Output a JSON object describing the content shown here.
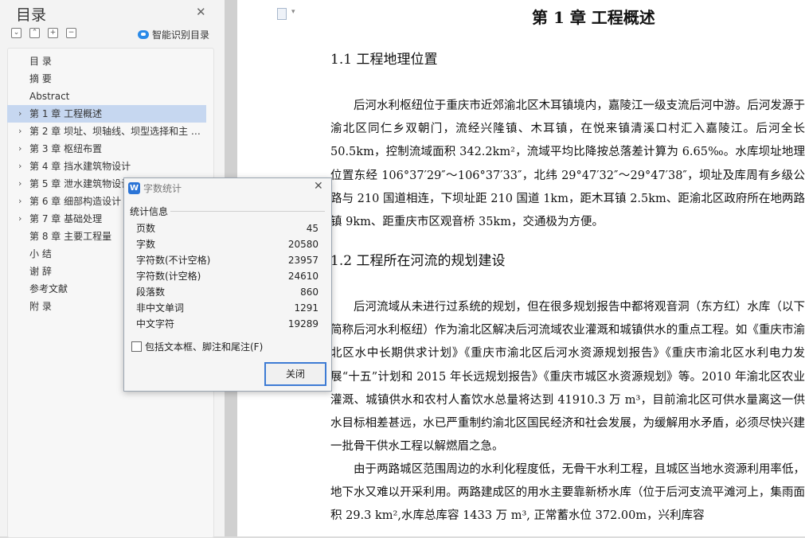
{
  "sidebar": {
    "title": "目录",
    "smart_label": "智能识别目录",
    "tools": [
      "collapse-all-icon",
      "expand-all-icon",
      "add-icon",
      "remove-icon"
    ],
    "items": [
      {
        "label": "目 录",
        "arrow": false,
        "active": false
      },
      {
        "label": "摘 要",
        "arrow": false,
        "active": false
      },
      {
        "label": "Abstract",
        "arrow": false,
        "active": false
      },
      {
        "label": "第 1 章  工程概述",
        "arrow": true,
        "active": true
      },
      {
        "label": "第 2 章  坝址、坝轴线、坝型选择和主 …",
        "arrow": true,
        "active": false
      },
      {
        "label": "第 3 章  枢纽布置",
        "arrow": true,
        "active": false
      },
      {
        "label": "第 4 章  挡水建筑物设计",
        "arrow": true,
        "active": false
      },
      {
        "label": "第 5 章  泄水建筑物设计",
        "arrow": true,
        "active": false
      },
      {
        "label": "第 6 章  细部构造设计",
        "arrow": true,
        "active": false
      },
      {
        "label": "第 7 章  基础处理",
        "arrow": true,
        "active": false
      },
      {
        "label": "第 8 章  主要工程量",
        "arrow": false,
        "active": false
      },
      {
        "label": "小  结",
        "arrow": false,
        "active": false
      },
      {
        "label": "谢  辞",
        "arrow": false,
        "active": false
      },
      {
        "label": "参考文献",
        "arrow": false,
        "active": false
      },
      {
        "label": "附 录",
        "arrow": false,
        "active": false
      }
    ]
  },
  "document": {
    "chapter_title": "第  1 章  工程概述",
    "h1_1": "1.1  工程地理位置",
    "p1": "后河水利枢纽位于重庆市近郊渝北区木耳镇境内，嘉陵江一级支流后河中游。后河发源于渝北区同仁乡双朝门，流经兴隆镇、木耳镇，在悦来镇清溪口村汇入嘉陵江。后河全长 50.5km，控制流域面积 342.2km²，流域平均比降按总落差计算为 6.65‰。水库坝址地理位置东经 106°37′29″～106°37′33″，北纬 29°47′32″～29°47′38″，坝址及库周有乡级公路与 210 国道相连，下坝址距 210 国道 1km，距木耳镇 2.5km、距渝北区政府所在地两路镇 9km、距重庆市区观音桥 35km，交通极为方便。",
    "h1_2": "1.2  工程所在河流的规划建设",
    "p2": "后河流域从未进行过系统的规划，但在很多规划报告中都将观音洞（东方红）水库（以下简称后河水利枢纽）作为渝北区解决后河流域农业灌溉和城镇供水的重点工程。如《重庆市渝北区水中长期供求计划》《重庆市渝北区后河水资源规划报告》《重庆市渝北区水利电力发展“十五”计划和 2015 年长远规划报告》《重庆市城区水资源规划》等。2010 年渝北区农业灌溉、城镇供水和农村人畜饮水总量将达到 41910.3 万 m³，目前渝北区可供水量离这一供水目标相差甚远，水已严重制约渝北区国民经济和社会发展，为缓解用水矛盾，必须尽快兴建一批骨干供水工程以解燃眉之急。",
    "p3": "由于两路城区范围周边的水利化程度低，无骨干水利工程，且城区当地水资源利用率低，地下水又难以开采利用。两路建成区的用水主要靠新桥水库（位于后河支流平滩河上，集雨面积 29.3 km²,水库总库容 1433 万 m³, 正常蓄水位 372.00m，兴利库容"
  },
  "dialog": {
    "title": "字数统计",
    "group_label": "统计信息",
    "stats": [
      {
        "key": "页数",
        "value": "45"
      },
      {
        "key": "字数",
        "value": "20580"
      },
      {
        "key": "字符数(不计空格)",
        "value": "23957"
      },
      {
        "key": "字符数(计空格)",
        "value": "24610"
      },
      {
        "key": "段落数",
        "value": "860"
      },
      {
        "key": "非中文单词",
        "value": "1291"
      },
      {
        "key": "中文字符",
        "value": "19289"
      }
    ],
    "checkbox_label": "包括文本框、脚注和尾注(F)",
    "checkbox_checked": false,
    "close_button": "关闭"
  }
}
